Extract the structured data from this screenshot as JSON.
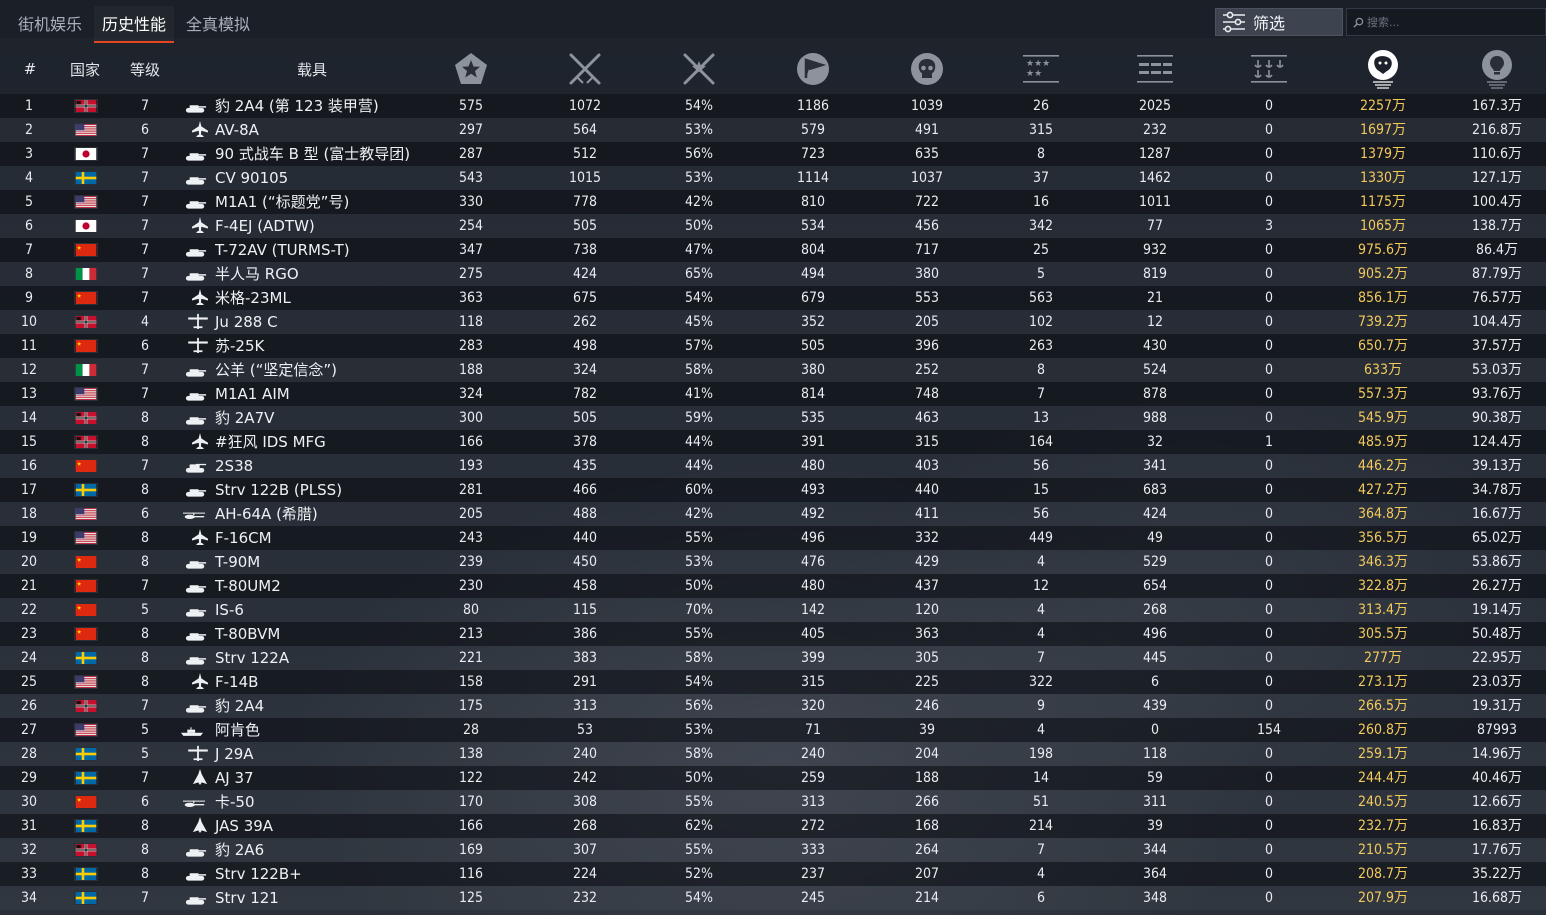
{
  "tabs": [
    {
      "label": "街机娱乐",
      "active": false
    },
    {
      "label": "历史性能",
      "active": true
    },
    {
      "label": "全真模拟",
      "active": false
    }
  ],
  "filter": {
    "label": "筛选",
    "icon": "filter-sliders-icon"
  },
  "search": {
    "placeholder": "搜索..."
  },
  "colors": {
    "accent": "#e5451f",
    "gold": "#f4c95d",
    "background": "#1b2029"
  },
  "columns": [
    {
      "key": "rank",
      "label": "#"
    },
    {
      "key": "country",
      "label": "国家"
    },
    {
      "key": "tier",
      "label": "等级"
    },
    {
      "key": "vehicle",
      "label": "载具"
    },
    {
      "key": "battles",
      "icon": "star-badge-icon"
    },
    {
      "key": "wins",
      "icon": "crossed-swords-icon"
    },
    {
      "key": "winrate",
      "icon": "crossed-swords-percent-icon"
    },
    {
      "key": "air_kills",
      "icon": "flag-emblem-icon"
    },
    {
      "key": "ground_kills",
      "icon": "skull-icon"
    },
    {
      "key": "naval_stars",
      "icon": "three-stars-icon"
    },
    {
      "key": "stat_a",
      "icon": "wing-bars-icon"
    },
    {
      "key": "stat_b",
      "icon": "anchor-rows-icon"
    },
    {
      "key": "silver",
      "icon": "lion-icon"
    },
    {
      "key": "rp",
      "icon": "lightbulb-icon"
    }
  ],
  "rows": [
    {
      "rank": "1",
      "nation": "germany",
      "tier": "7",
      "type": "tank",
      "name": "豹 2A4 (第 123 装甲营)",
      "v": [
        "575",
        "1072",
        "54%",
        "1186",
        "1039",
        "26",
        "2025",
        "0",
        "2257万",
        "167.3万"
      ]
    },
    {
      "rank": "2",
      "nation": "usa",
      "tier": "6",
      "type": "jet",
      "name": "AV-8A",
      "v": [
        "297",
        "564",
        "53%",
        "579",
        "491",
        "315",
        "232",
        "0",
        "1697万",
        "216.8万"
      ]
    },
    {
      "rank": "3",
      "nation": "japan",
      "tier": "7",
      "type": "tank",
      "name": "90 式战车 B 型 (富士教导团)",
      "v": [
        "287",
        "512",
        "56%",
        "723",
        "635",
        "8",
        "1287",
        "0",
        "1379万",
        "110.6万"
      ]
    },
    {
      "rank": "4",
      "nation": "sweden",
      "tier": "7",
      "type": "tank",
      "name": "CV 90105",
      "v": [
        "543",
        "1015",
        "53%",
        "1114",
        "1037",
        "37",
        "1462",
        "0",
        "1330万",
        "127.1万"
      ]
    },
    {
      "rank": "5",
      "nation": "usa",
      "tier": "7",
      "type": "tank",
      "name": "M1A1 (“标题党”号)",
      "v": [
        "330",
        "778",
        "42%",
        "810",
        "722",
        "16",
        "1011",
        "0",
        "1175万",
        "100.4万"
      ]
    },
    {
      "rank": "6",
      "nation": "japan",
      "tier": "7",
      "type": "jet",
      "name": "F-4EJ (ADTW)",
      "v": [
        "254",
        "505",
        "50%",
        "534",
        "456",
        "342",
        "77",
        "3",
        "1065万",
        "138.7万"
      ]
    },
    {
      "rank": "7",
      "nation": "china",
      "tier": "7",
      "type": "tank",
      "name": "T-72AV (TURMS-T)",
      "v": [
        "347",
        "738",
        "47%",
        "804",
        "717",
        "25",
        "932",
        "0",
        "975.6万",
        "86.4万"
      ]
    },
    {
      "rank": "8",
      "nation": "italy",
      "tier": "7",
      "type": "tank",
      "name": "半人马 RGO",
      "v": [
        "275",
        "424",
        "65%",
        "494",
        "380",
        "5",
        "819",
        "0",
        "905.2万",
        "87.79万"
      ]
    },
    {
      "rank": "9",
      "nation": "china",
      "tier": "7",
      "type": "jet",
      "name": "米格-23ML",
      "v": [
        "363",
        "675",
        "54%",
        "679",
        "553",
        "563",
        "21",
        "0",
        "856.1万",
        "76.57万"
      ]
    },
    {
      "rank": "10",
      "nation": "germany",
      "tier": "4",
      "type": "plane",
      "name": "Ju 288 C",
      "v": [
        "118",
        "262",
        "45%",
        "352",
        "205",
        "102",
        "12",
        "0",
        "739.2万",
        "104.4万"
      ]
    },
    {
      "rank": "11",
      "nation": "china",
      "tier": "6",
      "type": "plane",
      "name": "苏-25K",
      "v": [
        "283",
        "498",
        "57%",
        "505",
        "396",
        "263",
        "430",
        "0",
        "650.7万",
        "37.57万"
      ]
    },
    {
      "rank": "12",
      "nation": "italy",
      "tier": "7",
      "type": "tank",
      "name": "公羊 (“坚定信念”)",
      "v": [
        "188",
        "324",
        "58%",
        "380",
        "252",
        "8",
        "524",
        "0",
        "633万",
        "53.03万"
      ]
    },
    {
      "rank": "13",
      "nation": "usa",
      "tier": "7",
      "type": "tank",
      "name": "M1A1 AIM",
      "v": [
        "324",
        "782",
        "41%",
        "814",
        "748",
        "7",
        "878",
        "0",
        "557.3万",
        "93.76万"
      ]
    },
    {
      "rank": "14",
      "nation": "germany",
      "tier": "8",
      "type": "tank",
      "name": "豹 2A7V",
      "v": [
        "300",
        "505",
        "59%",
        "535",
        "463",
        "13",
        "988",
        "0",
        "545.9万",
        "90.38万"
      ]
    },
    {
      "rank": "15",
      "nation": "germany",
      "tier": "8",
      "type": "jet",
      "name": "#狂风 IDS MFG",
      "v": [
        "166",
        "378",
        "44%",
        "391",
        "315",
        "164",
        "32",
        "1",
        "485.9万",
        "124.4万"
      ]
    },
    {
      "rank": "16",
      "nation": "china",
      "tier": "7",
      "type": "spaa",
      "name": "2S38",
      "v": [
        "193",
        "435",
        "44%",
        "480",
        "403",
        "56",
        "341",
        "0",
        "446.2万",
        "39.13万"
      ]
    },
    {
      "rank": "17",
      "nation": "sweden",
      "tier": "8",
      "type": "tank",
      "name": "Strv 122B (PLSS)",
      "v": [
        "281",
        "466",
        "60%",
        "493",
        "440",
        "15",
        "683",
        "0",
        "427.2万",
        "34.78万"
      ]
    },
    {
      "rank": "18",
      "nation": "usa",
      "tier": "6",
      "type": "heli",
      "name": "AH-64A (希腊)",
      "v": [
        "205",
        "488",
        "42%",
        "492",
        "411",
        "56",
        "424",
        "0",
        "364.8万",
        "16.67万"
      ]
    },
    {
      "rank": "19",
      "nation": "usa",
      "tier": "8",
      "type": "jet",
      "name": "F-16CM",
      "v": [
        "243",
        "440",
        "55%",
        "496",
        "332",
        "449",
        "49",
        "0",
        "356.5万",
        "65.02万"
      ]
    },
    {
      "rank": "20",
      "nation": "china",
      "tier": "8",
      "type": "tank",
      "name": "T-90M",
      "v": [
        "239",
        "450",
        "53%",
        "476",
        "429",
        "4",
        "529",
        "0",
        "346.3万",
        "53.86万"
      ]
    },
    {
      "rank": "21",
      "nation": "china",
      "tier": "7",
      "type": "tank",
      "name": "T-80UM2",
      "v": [
        "230",
        "458",
        "50%",
        "480",
        "437",
        "12",
        "654",
        "0",
        "322.8万",
        "26.27万"
      ]
    },
    {
      "rank": "22",
      "nation": "china",
      "tier": "5",
      "type": "tank",
      "name": "IS-6",
      "v": [
        "80",
        "115",
        "70%",
        "142",
        "120",
        "4",
        "268",
        "0",
        "313.4万",
        "19.14万"
      ]
    },
    {
      "rank": "23",
      "nation": "china",
      "tier": "8",
      "type": "tank",
      "name": "T-80BVM",
      "v": [
        "213",
        "386",
        "55%",
        "405",
        "363",
        "4",
        "496",
        "0",
        "305.5万",
        "50.48万"
      ]
    },
    {
      "rank": "24",
      "nation": "sweden",
      "tier": "8",
      "type": "tank",
      "name": "Strv 122A",
      "v": [
        "221",
        "383",
        "58%",
        "399",
        "305",
        "7",
        "445",
        "0",
        "277万",
        "22.95万"
      ]
    },
    {
      "rank": "25",
      "nation": "usa",
      "tier": "8",
      "type": "jet",
      "name": "F-14B",
      "v": [
        "158",
        "291",
        "54%",
        "315",
        "225",
        "322",
        "6",
        "0",
        "273.1万",
        "23.03万"
      ]
    },
    {
      "rank": "26",
      "nation": "germany",
      "tier": "7",
      "type": "tank",
      "name": "豹 2A4",
      "v": [
        "175",
        "313",
        "56%",
        "320",
        "246",
        "9",
        "439",
        "0",
        "266.5万",
        "19.31万"
      ]
    },
    {
      "rank": "27",
      "nation": "usa",
      "tier": "5",
      "type": "ship",
      "name": "阿肯色",
      "v": [
        "28",
        "53",
        "53%",
        "71",
        "39",
        "4",
        "0",
        "154",
        "260.8万",
        "87993"
      ]
    },
    {
      "rank": "28",
      "nation": "sweden",
      "tier": "5",
      "type": "plane",
      "name": "J 29A",
      "v": [
        "138",
        "240",
        "58%",
        "240",
        "204",
        "198",
        "118",
        "0",
        "259.1万",
        "14.96万"
      ]
    },
    {
      "rank": "29",
      "nation": "sweden",
      "tier": "7",
      "type": "delta",
      "name": "AJ 37",
      "v": [
        "122",
        "242",
        "50%",
        "259",
        "188",
        "14",
        "59",
        "0",
        "244.4万",
        "40.46万"
      ]
    },
    {
      "rank": "30",
      "nation": "china",
      "tier": "6",
      "type": "heli",
      "name": "卡-50",
      "v": [
        "170",
        "308",
        "55%",
        "313",
        "266",
        "51",
        "311",
        "0",
        "240.5万",
        "12.66万"
      ]
    },
    {
      "rank": "31",
      "nation": "sweden",
      "tier": "8",
      "type": "delta",
      "name": "JAS 39A",
      "v": [
        "166",
        "268",
        "62%",
        "272",
        "168",
        "214",
        "39",
        "0",
        "232.7万",
        "16.83万"
      ]
    },
    {
      "rank": "32",
      "nation": "germany",
      "tier": "8",
      "type": "tank",
      "name": "豹 2A6",
      "v": [
        "169",
        "307",
        "55%",
        "333",
        "264",
        "7",
        "344",
        "0",
        "210.5万",
        "17.76万"
      ]
    },
    {
      "rank": "33",
      "nation": "sweden",
      "tier": "8",
      "type": "tank",
      "name": "Strv 122B+",
      "v": [
        "116",
        "224",
        "52%",
        "237",
        "207",
        "4",
        "364",
        "0",
        "208.7万",
        "35.22万"
      ]
    },
    {
      "rank": "34",
      "nation": "sweden",
      "tier": "7",
      "type": "tank",
      "name": "Strv 121",
      "v": [
        "125",
        "232",
        "54%",
        "245",
        "214",
        "6",
        "348",
        "0",
        "207.9万",
        "16.68万"
      ]
    }
  ]
}
